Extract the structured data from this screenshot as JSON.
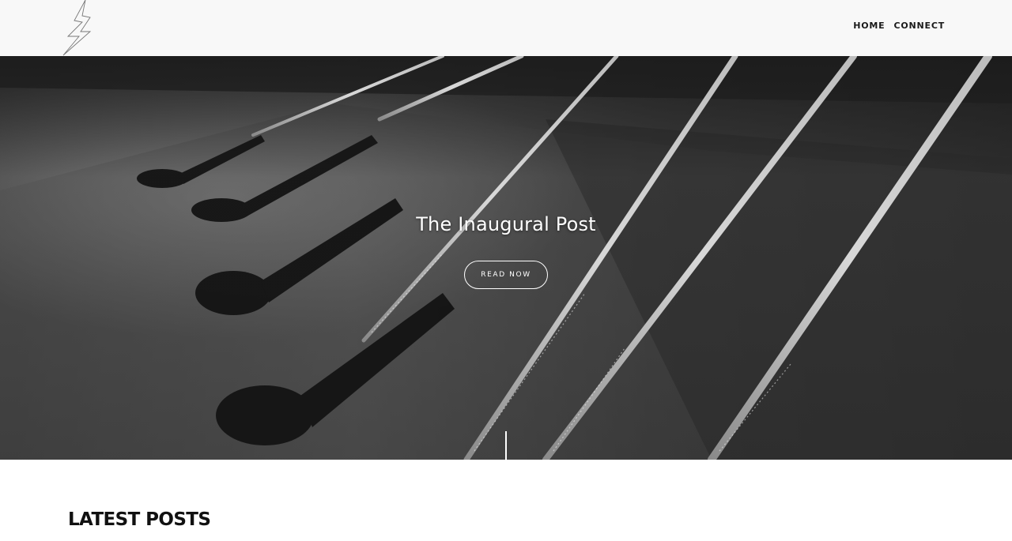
{
  "cursor": {
    "icon": "resize-arrow-icon"
  },
  "header": {
    "logo": {
      "icon": "lightning-bolt-icon"
    },
    "nav": [
      {
        "label": "HOME"
      },
      {
        "label": "CONNECT"
      }
    ]
  },
  "hero": {
    "background": "guitar-strings-photo",
    "title": "The Inaugural Post",
    "button_label": "READ NOW"
  },
  "latest": {
    "heading": "LATEST POSTS"
  },
  "colors": {
    "header_bg": "#f8f8f8",
    "text_dark": "#111111",
    "hero_text": "#ffffff"
  }
}
